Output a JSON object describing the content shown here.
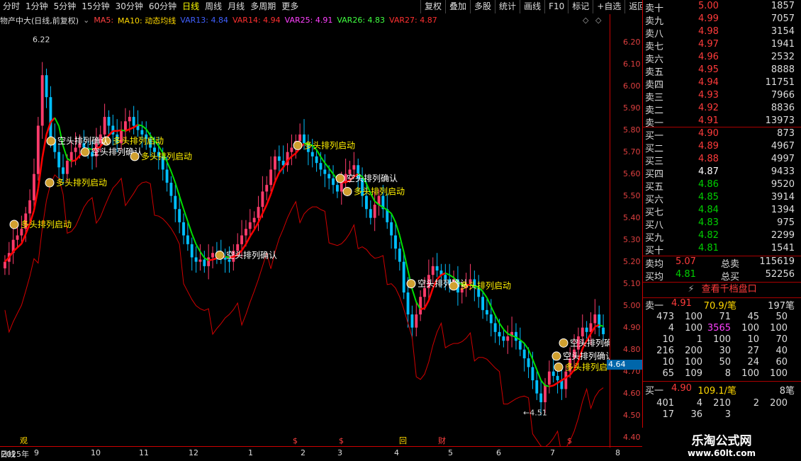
{
  "tabs": [
    "分时",
    "1分钟",
    "5分钟",
    "15分钟",
    "30分钟",
    "60分钟",
    "日线",
    "周线",
    "月线",
    "多周期",
    "更多"
  ],
  "tab_active": 6,
  "toolbar": [
    "复权",
    "叠加",
    "多股",
    "统计",
    "画线",
    "F10",
    "标记",
    "+自选",
    "返回"
  ],
  "legend": {
    "stock": "物产中大(日线,前复权)",
    "ma5": "MA5:",
    "ma10": "MA10: 动态均线",
    "var13": "VAR13: 4.84",
    "var14": "VAR14: 4.94",
    "var25": "VAR25: 4.91",
    "var26": "VAR26: 4.83",
    "var27": "VAR27: 4.87"
  },
  "chart_data": {
    "type": "candlestick",
    "ylim": [
      4.36,
      6.27
    ],
    "yticks": [
      "6.20",
      "6.10",
      "6.00",
      "5.90",
      "5.80",
      "5.70",
      "5.60",
      "5.50",
      "5.40",
      "5.30",
      "5.20",
      "5.10",
      "5.00",
      "4.90",
      "4.80",
      "4.70",
      "4.60",
      "4.50",
      "4.40"
    ],
    "xlabels": [
      "2025年",
      "9",
      "10",
      "11",
      "12",
      "1",
      "2",
      "3",
      "4",
      "5",
      "6",
      "7",
      "8",
      "日线"
    ],
    "high_label": "6.22",
    "low_label": "4.51",
    "current_price": "4.64",
    "close": [
      5.2,
      5.24,
      5.3,
      5.32,
      5.35,
      5.42,
      5.48,
      5.6,
      5.82,
      6.05,
      5.95,
      5.76,
      5.7,
      5.63,
      5.6,
      5.66,
      5.7,
      5.72,
      5.74,
      5.72,
      5.7,
      5.68,
      5.74,
      5.78,
      5.86,
      5.82,
      5.78,
      5.74,
      5.8,
      5.84,
      5.86,
      5.82,
      5.8,
      5.78,
      5.76,
      5.72,
      5.7,
      5.68,
      5.62,
      5.56,
      5.5,
      5.44,
      5.38,
      5.32,
      5.28,
      5.22,
      5.2,
      5.21,
      5.18,
      5.22,
      5.24,
      5.23,
      5.22,
      5.21,
      5.2,
      5.25,
      5.28,
      5.32,
      5.35,
      5.38,
      5.4,
      5.45,
      5.52,
      5.55,
      5.62,
      5.68,
      5.66,
      5.64,
      5.7,
      5.72,
      5.75,
      5.78,
      5.74,
      5.7,
      5.68,
      5.65,
      5.62,
      5.6,
      5.58,
      5.55,
      5.52,
      5.56,
      5.6,
      5.62,
      5.64,
      5.58,
      5.5,
      5.44,
      5.4,
      5.46,
      5.5,
      5.44,
      5.38,
      5.32,
      5.26,
      5.2,
      5.06,
      4.96,
      4.9,
      4.96,
      5.04,
      5.08,
      5.14,
      5.18,
      5.16,
      5.14,
      5.12,
      5.1,
      5.12,
      5.06,
      5.08,
      5.1,
      5.12,
      5.08,
      5.04,
      4.98,
      4.96,
      4.92,
      4.88,
      4.86,
      4.84,
      4.86,
      4.88,
      4.84,
      4.8,
      4.76,
      4.72,
      4.66,
      4.6,
      4.56,
      4.64,
      4.7,
      4.68,
      4.66,
      4.62,
      4.7,
      4.76,
      4.8,
      4.86,
      4.9,
      4.88,
      4.92,
      4.96,
      4.9,
      4.87
    ],
    "annotations": [
      {
        "text": "多头排列启动",
        "color": "#fff000"
      },
      {
        "text": "多头排列启动",
        "color": "#fff000"
      },
      {
        "text": "空头排列确认",
        "color": "#ffffff"
      },
      {
        "text": "多头排列启动",
        "color": "#fff000"
      },
      {
        "text": "空头排列确认",
        "color": "#ffffff"
      },
      {
        "text": "空头排列确认",
        "color": "#ffffff"
      },
      {
        "text": "多头排列启动",
        "color": "#fff000"
      },
      {
        "text": "多头排列启动",
        "color": "#fff000"
      },
      {
        "text": "空头排列确认",
        "color": "#ffffff"
      },
      {
        "text": "多头排列启动",
        "color": "#fff000"
      },
      {
        "text": "空头排列确认",
        "color": "#ffffff"
      },
      {
        "text": "多头排列启动",
        "color": "#fff000"
      },
      {
        "text": "空头排列确认",
        "color": "#ffffff"
      },
      {
        "text": "多头排列启动",
        "color": "#fff000"
      },
      {
        "text": "空头排列确认",
        "color": "#ffffff"
      }
    ],
    "bottom_marks": [
      "观",
      "$",
      "$",
      "回",
      "财",
      "$"
    ]
  },
  "orderbook": {
    "asks": [
      {
        "label": "卖十",
        "price": "5.00",
        "vol": "1857"
      },
      {
        "label": "卖九",
        "price": "4.99",
        "vol": "7057"
      },
      {
        "label": "卖八",
        "price": "4.98",
        "vol": "3154"
      },
      {
        "label": "卖七",
        "price": "4.97",
        "vol": "1941"
      },
      {
        "label": "卖六",
        "price": "4.96",
        "vol": "2532"
      },
      {
        "label": "卖五",
        "price": "4.95",
        "vol": "8888"
      },
      {
        "label": "卖四",
        "price": "4.94",
        "vol": "11751"
      },
      {
        "label": "卖三",
        "price": "4.93",
        "vol": "7966"
      },
      {
        "label": "卖二",
        "price": "4.92",
        "vol": "8836"
      },
      {
        "label": "卖一",
        "price": "4.91",
        "vol": "13973"
      }
    ],
    "bids": [
      {
        "label": "买一",
        "price": "4.90",
        "vol": "873",
        "c": "red"
      },
      {
        "label": "买二",
        "price": "4.89",
        "vol": "4967",
        "c": "red"
      },
      {
        "label": "买三",
        "price": "4.88",
        "vol": "4997",
        "c": "red"
      },
      {
        "label": "买四",
        "price": "4.87",
        "vol": "9433",
        "c": "wht"
      },
      {
        "label": "买五",
        "price": "4.86",
        "vol": "9520",
        "c": "grn"
      },
      {
        "label": "买六",
        "price": "4.85",
        "vol": "3914",
        "c": "grn"
      },
      {
        "label": "买七",
        "price": "4.84",
        "vol": "1394",
        "c": "grn"
      },
      {
        "label": "买八",
        "price": "4.83",
        "vol": "975",
        "c": "grn"
      },
      {
        "label": "买九",
        "price": "4.82",
        "vol": "2299",
        "c": "grn"
      },
      {
        "label": "买十",
        "price": "4.81",
        "vol": "1541",
        "c": "grn"
      }
    ],
    "avg_sell_label": "卖均",
    "avg_sell": "5.07",
    "total_sell_label": "总卖",
    "total_sell": "115619",
    "avg_buy_label": "买均",
    "avg_buy": "4.81",
    "total_buy_label": "总买",
    "total_buy": "52256"
  },
  "thousand": {
    "label": "查看千档盘口"
  },
  "sell_one": {
    "label": "卖一",
    "price": "4.91",
    "per": "70.9/笔",
    "count": "197笔",
    "grid": [
      [
        "473",
        "100",
        "71",
        "45",
        "50"
      ],
      [
        "4",
        "100",
        "3565",
        "100",
        "100"
      ],
      [
        "10",
        "1",
        "100",
        "10",
        "70"
      ],
      [
        "216",
        "200",
        "30",
        "27",
        "40"
      ],
      [
        "10",
        "100",
        "50",
        "24",
        "60"
      ],
      [
        "65",
        "109",
        "8",
        "100",
        "100"
      ]
    ]
  },
  "buy_one": {
    "label": "买一",
    "price": "4.90",
    "per": "109.1/笔",
    "count": "8笔",
    "grid": [
      [
        "401",
        "4",
        "210",
        "2",
        "200"
      ],
      [
        "17",
        "36",
        "3",
        "",
        ""
      ]
    ]
  },
  "watermark": {
    "title": "乐淘公式网",
    "url": "www.60lt.com"
  },
  "colors": {
    "up": "#ff3b6b",
    "down": "#00bfff",
    "ma_up": "#ff0000",
    "ma_down": "#00e000",
    "red_line": "#d00000"
  }
}
